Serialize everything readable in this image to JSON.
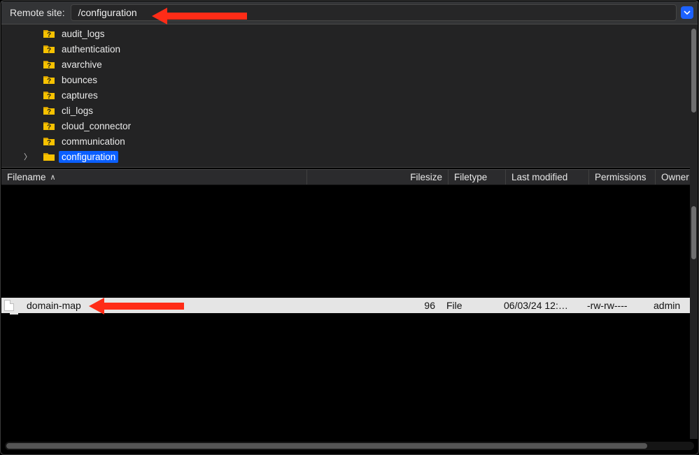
{
  "topbar": {
    "label": "Remote site:",
    "path": "/configuration"
  },
  "tree": {
    "items": [
      {
        "name": "audit_logs",
        "unknown": true,
        "selected": false,
        "expandable": false
      },
      {
        "name": "authentication",
        "unknown": true,
        "selected": false,
        "expandable": false
      },
      {
        "name": "avarchive",
        "unknown": true,
        "selected": false,
        "expandable": false
      },
      {
        "name": "bounces",
        "unknown": true,
        "selected": false,
        "expandable": false
      },
      {
        "name": "captures",
        "unknown": true,
        "selected": false,
        "expandable": false
      },
      {
        "name": "cli_logs",
        "unknown": true,
        "selected": false,
        "expandable": false
      },
      {
        "name": "cloud_connector",
        "unknown": true,
        "selected": false,
        "expandable": false
      },
      {
        "name": "communication",
        "unknown": true,
        "selected": false,
        "expandable": false
      },
      {
        "name": "configuration",
        "unknown": false,
        "selected": true,
        "expandable": true
      }
    ]
  },
  "columns": {
    "filename": "Filename",
    "filesize": "Filesize",
    "filetype": "Filetype",
    "lastmod": "Last modified",
    "perms": "Permissions",
    "owner": "Owner"
  },
  "files": [
    {
      "name": "domain-map",
      "size": "96",
      "type": "File",
      "modified": "06/03/24 12:…",
      "permissions": "-rw-rw----",
      "owner": "admin",
      "selected": true
    }
  ]
}
